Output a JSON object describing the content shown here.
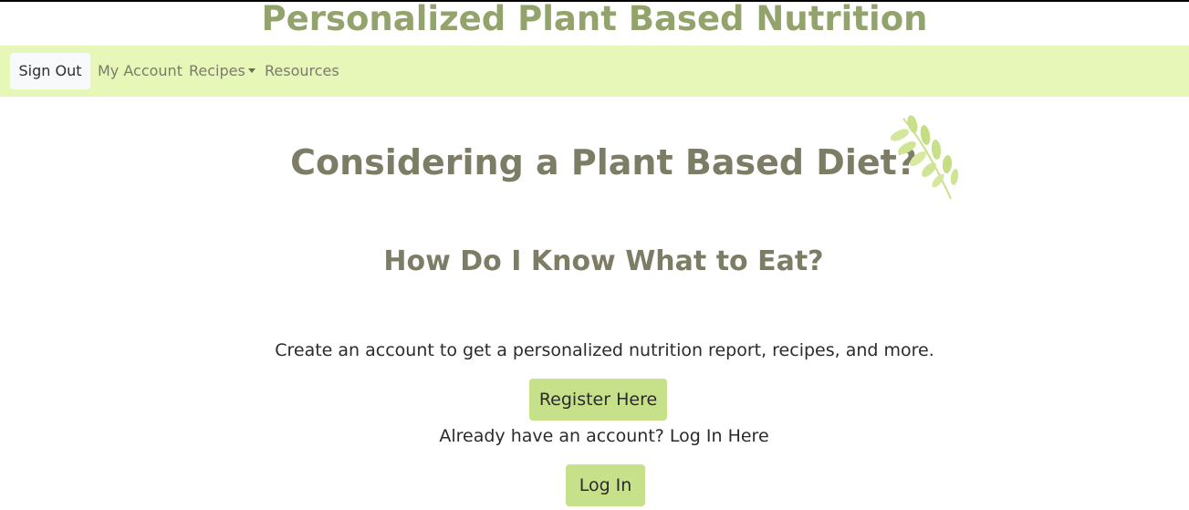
{
  "site": {
    "title": "Personalized Plant Based Nutrition"
  },
  "nav": {
    "sign_out": "Sign Out",
    "my_account": "My Account",
    "recipes": "Recipes",
    "resources": "Resources"
  },
  "hero": {
    "title": "Considering a Plant Based Diet?",
    "subtitle": "How Do I Know What to Eat?",
    "blurb": "Create an account to get a personalized nutrition report, recipes, and more.",
    "register_label": "Register Here",
    "login_prompt": "Already have an account? Log In Here",
    "login_label": "Log In"
  },
  "icons": {
    "leaf": "leaf-branch-icon",
    "recipes_dropdown": "caret-down-icon"
  },
  "colors": {
    "title": "#93a36c",
    "nav_bg": "#e6f7b7",
    "button": "#c7e08a",
    "heading": "#7d7d66",
    "leaf": "#c9e08a"
  }
}
